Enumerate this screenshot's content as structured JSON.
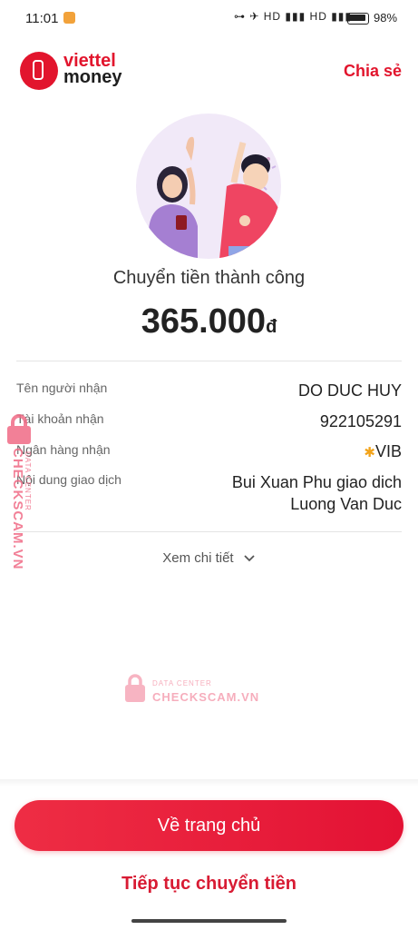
{
  "status_bar": {
    "time": "11:01",
    "indicators": "⊶ ✈ HD ▮▮▮ HD ▮▮▮ ◔",
    "battery": "98%"
  },
  "header": {
    "brand_top": "viettel",
    "brand_bottom": "money",
    "share_label": "Chia sẻ"
  },
  "result": {
    "title": "Chuyển tiền thành công",
    "amount": "365.000",
    "currency": "đ"
  },
  "details": [
    {
      "label": "Tên người nhận",
      "value": "DO DUC HUY"
    },
    {
      "label": "Tài khoản nhận",
      "value": "922105291"
    },
    {
      "label": "Ngân hàng nhận",
      "value": "VIB"
    },
    {
      "label": "Nội dung giao dịch",
      "value_line1": "Bui Xuan Phu giao dich",
      "value_line2": "Luong Van Duc"
    }
  ],
  "detail_link": "Xem chi tiết",
  "watermark": {
    "top": "DATA CENTER",
    "bottom": "CHECKSCAM.VN"
  },
  "actions": {
    "home": "Về trang chủ",
    "continue": "Tiếp tục chuyển tiền"
  },
  "colors": {
    "brand_red": "#e2152d",
    "watermark_pink": "#f06b86"
  }
}
